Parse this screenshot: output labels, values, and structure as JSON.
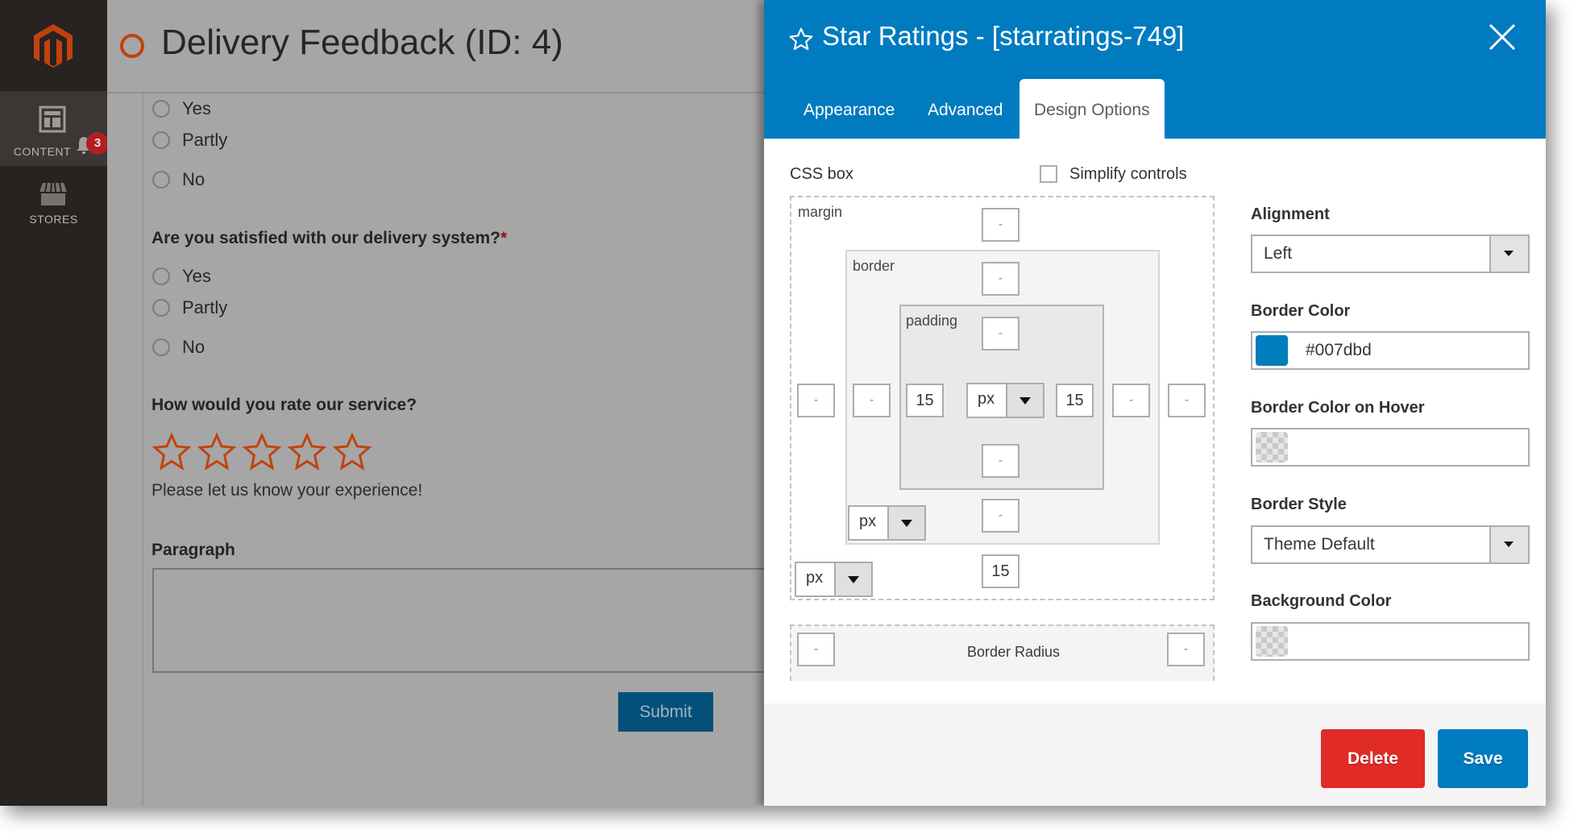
{
  "sidebar": {
    "items": [
      {
        "label": "CONTENT",
        "icon": "layout-icon",
        "notifications": "3"
      },
      {
        "label": "STORES",
        "icon": "store-icon"
      }
    ]
  },
  "page": {
    "title": "Delivery Feedback (ID: 4)",
    "form": {
      "group1_options": [
        "Yes",
        "Partly",
        "No"
      ],
      "question2": "Are you satisfied with our delivery system?",
      "question2_required": "*",
      "group2_options": [
        "Yes",
        "Partly",
        "No"
      ],
      "rating_question": "How would you rate our service?",
      "rating_stars": 5,
      "rating_value": 0,
      "rating_helper": "Please let us know your experience!",
      "paragraph_label": "Paragraph",
      "paragraph_value": "",
      "submit_label": "Submit"
    }
  },
  "panel": {
    "title": "Star Ratings - [starratings-749]",
    "tabs": [
      {
        "label": "Appearance",
        "active": false
      },
      {
        "label": "Advanced",
        "active": false
      },
      {
        "label": "Design Options",
        "active": true
      }
    ],
    "css_box": {
      "label": "CSS box",
      "simplify_label": "Simplify controls",
      "simplify_checked": false,
      "margin_label": "margin",
      "border_label": "border",
      "padding_label": "padding",
      "margin": {
        "top": "-",
        "right": "-",
        "bottom": "15",
        "left": "-",
        "unit": "px"
      },
      "border": {
        "top": "-",
        "right": "-",
        "bottom": "-",
        "left": "-",
        "unit": "px"
      },
      "padding": {
        "top": "-",
        "right": "15",
        "bottom": "-",
        "left": "15",
        "unit": "px"
      },
      "border_radius_label": "Border Radius",
      "border_radius": {
        "left": "-",
        "right": "-"
      }
    },
    "options": {
      "alignment_label": "Alignment",
      "alignment_value": "Left",
      "border_color_label": "Border Color",
      "border_color_value": "#007dbd",
      "border_color_hover_label": "Border Color on Hover",
      "border_color_hover_value": "",
      "border_style_label": "Border Style",
      "border_style_value": "Theme Default",
      "background_color_label": "Background Color",
      "background_color_value": ""
    },
    "footer": {
      "delete_label": "Delete",
      "save_label": "Save"
    }
  },
  "colors": {
    "panel_header": "#007bbf",
    "delete": "#e02b27",
    "save": "#007bbf",
    "accent_orange": "#c2410c",
    "submit": "#04507a"
  }
}
